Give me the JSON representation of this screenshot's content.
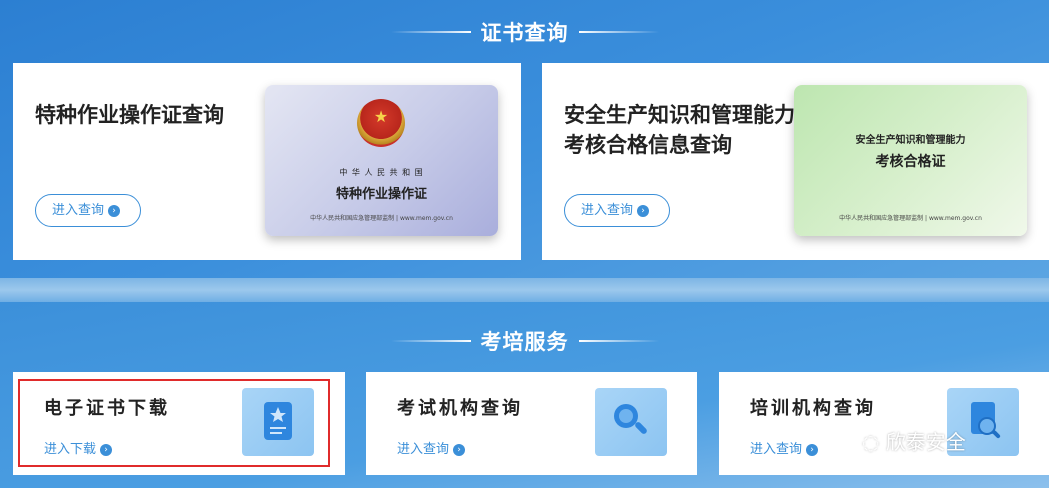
{
  "sections": {
    "cert_query_title": "证书查询",
    "training_title": "考培服务"
  },
  "cards": {
    "special_ops": {
      "title": "特种作业操作证查询",
      "button": "进入查询",
      "cert": {
        "line1": "中 华 人 民 共 和 国",
        "line2": "特种作业操作证",
        "footer": "中华人民共和国应急管理部监制 | www.mem.gov.cn"
      }
    },
    "safety_mgmt": {
      "title_line1": "安全生产知识和管理能力",
      "title_line2": "考核合格信息查询",
      "button": "进入查询",
      "cert": {
        "line1": "安全生产知识和管理能力",
        "line2": "考核合格证",
        "footer": "中华人民共和国应急管理部监制 | www.mem.gov.cn"
      }
    }
  },
  "services": [
    {
      "title": "电子证书下载",
      "link": "进入下载",
      "icon": "certificate-icon"
    },
    {
      "title": "考试机构查询",
      "link": "进入查询",
      "icon": "magnifier-icon"
    },
    {
      "title": "培训机构查询",
      "link": "进入查询",
      "icon": "document-search-icon"
    }
  ],
  "watermark": "欣泰安全",
  "colors": {
    "accent": "#3b8fd8",
    "highlight": "#e02b2b"
  }
}
